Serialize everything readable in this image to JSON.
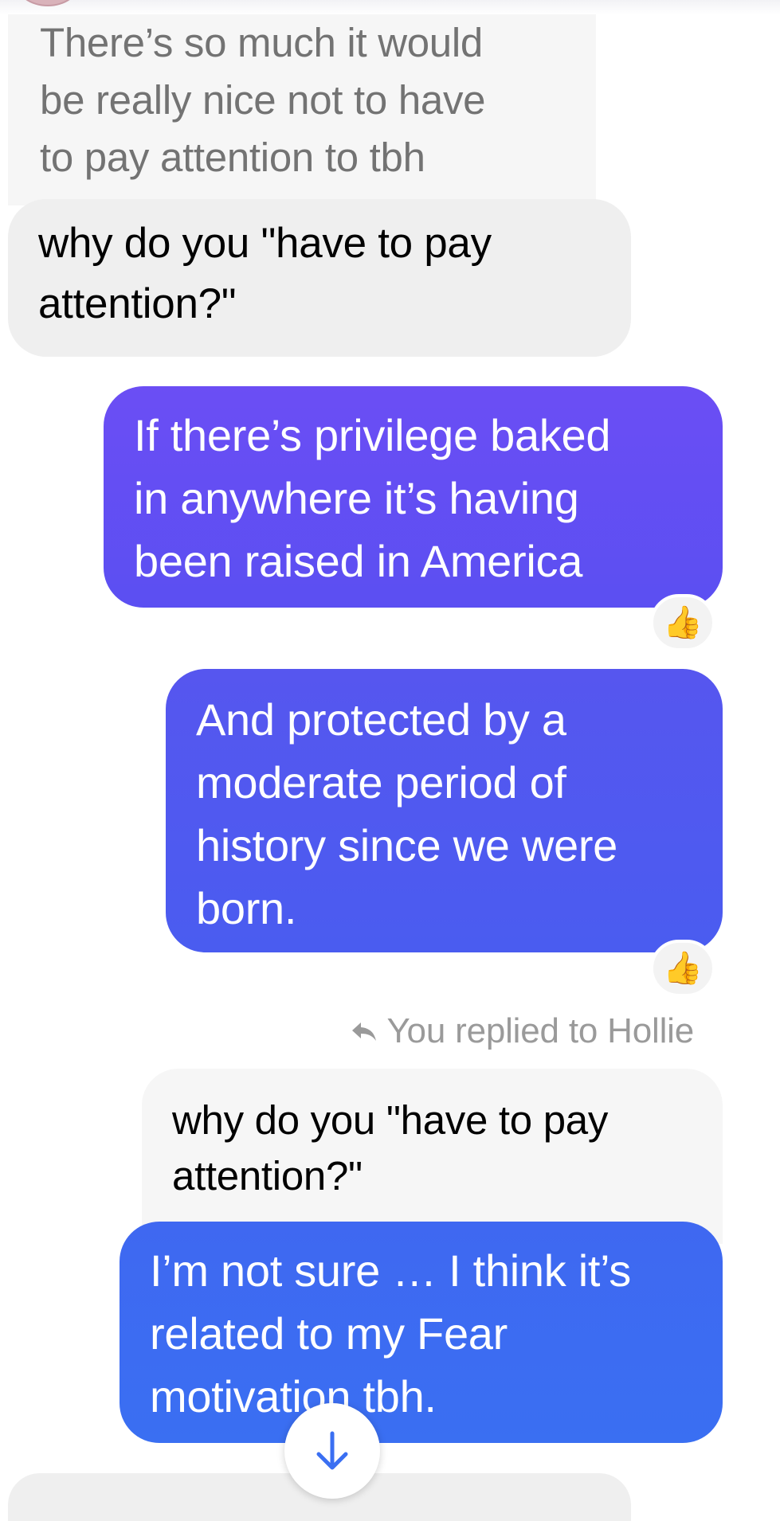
{
  "conversation": {
    "quoted_incoming": {
      "text": "There’s so much it would\nbe really nice not to have\nto pay attention to tbh"
    },
    "incoming_message": {
      "text": "why do you \"have to pay\nattention?\""
    },
    "outgoing_messages": [
      {
        "text": "If there’s privilege baked\nin anywhere it’s having\nbeen raised in America",
        "reaction": "👍"
      },
      {
        "text": "And protected by a\nmoderate period of\nhistory since we were\nborn.",
        "reaction": "👍"
      },
      {
        "text": "I’m not sure … I think it’s\nrelated to my Fear\nmotivation tbh."
      }
    ],
    "reply_context": {
      "label": "You replied to Hollie",
      "quoted_text": "why do you \"have to pay\nattention?\""
    }
  },
  "colors": {
    "outgoing_top": "#6b4ef4",
    "outgoing_mid": "#4a5cf0",
    "outgoing_bottom": "#3a6ff2",
    "incoming_bg": "#efefef",
    "quoted_bg": "#f6f6f6",
    "reply_label": "#9a9a9a",
    "scroll_arrow": "#3a6ff2"
  },
  "icons": {
    "reply": "reply-arrow-icon",
    "scroll": "arrow-down-icon",
    "reaction": "thumbs-up-icon"
  }
}
